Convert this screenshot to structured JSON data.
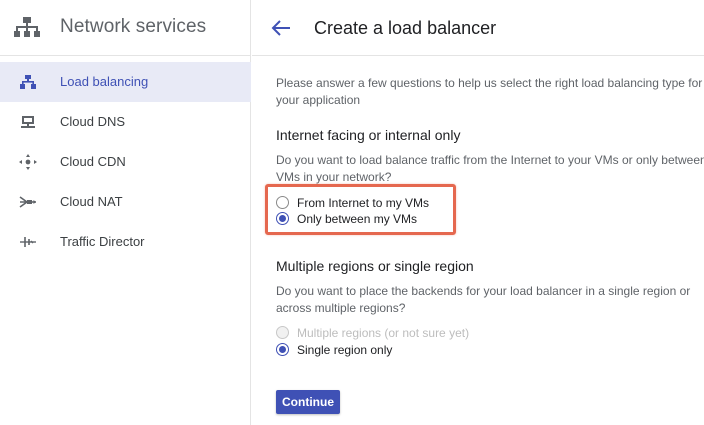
{
  "sidebar": {
    "product_title": "Network services",
    "items": [
      {
        "label": "Load balancing",
        "icon": "load-balancing-icon",
        "active": true
      },
      {
        "label": "Cloud DNS",
        "icon": "dns-icon",
        "active": false
      },
      {
        "label": "Cloud CDN",
        "icon": "cdn-icon",
        "active": false
      },
      {
        "label": "Cloud NAT",
        "icon": "nat-icon",
        "active": false
      },
      {
        "label": "Traffic Director",
        "icon": "traffic-director-icon",
        "active": false
      }
    ]
  },
  "header": {
    "title": "Create a load balancer"
  },
  "main": {
    "intro_line1": "Please answer a few questions to help us select the right load balancing type for",
    "intro_line2": "your application",
    "section1": {
      "title": "Internet facing or internal only",
      "desc_line1": "Do you want to load balance traffic from the Internet to your VMs or only between",
      "desc_line2": "VMs in your network?",
      "options": [
        {
          "label": "From Internet to my VMs",
          "checked": false,
          "disabled": false
        },
        {
          "label": "Only between my VMs",
          "checked": true,
          "disabled": false
        }
      ]
    },
    "section2": {
      "title": "Multiple regions or single region",
      "desc_line1": "Do you want to place the backends for your load balancer in a single region or",
      "desc_line2": "across multiple regions?",
      "options": [
        {
          "label": "Multiple regions (or not sure yet)",
          "checked": false,
          "disabled": true
        },
        {
          "label": "Single region only",
          "checked": true,
          "disabled": false
        }
      ]
    },
    "continue_label": "Continue"
  },
  "colors": {
    "accent": "#3f51b5",
    "active_nav_bg": "#e8eaf6",
    "highlight_border": "#e5684f"
  }
}
